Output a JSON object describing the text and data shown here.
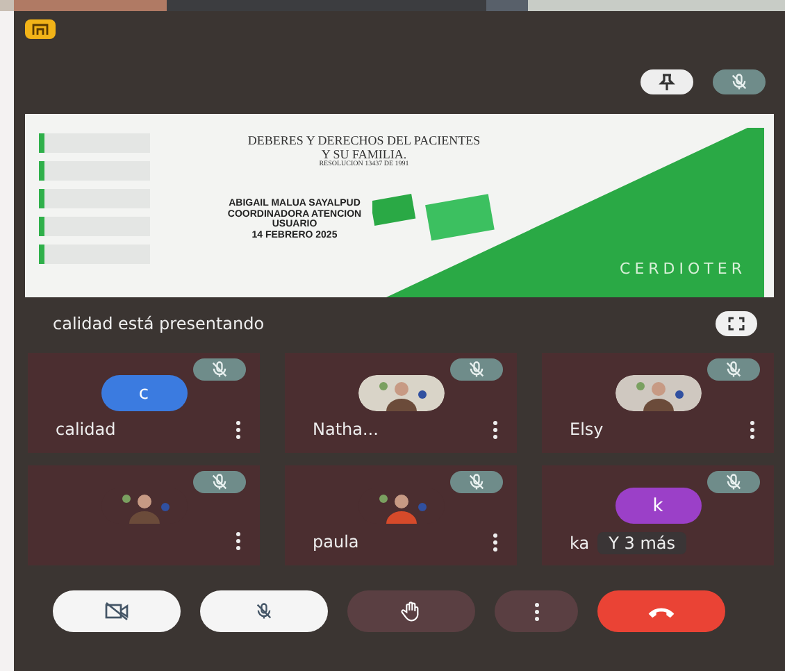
{
  "slide": {
    "title_lines": [
      "DEBERES Y DERECHOS DEL PACIENTES",
      "Y SU FAMILIA."
    ],
    "subtitle": "RESOLUCION 13437 DE 1991",
    "presenter_lines": [
      "ABIGAIL MALUA SAYALPUD",
      "COORDINADORA ATENCION",
      "USUARIO",
      "14 FEBRERO  2025"
    ],
    "brand": "CERDIOTER"
  },
  "presenting": "calidad está presentando",
  "participants": [
    {
      "name": "calidad",
      "kind": "letter",
      "letter": "c",
      "color": "#3b7be0",
      "muted": true
    },
    {
      "name": "Natha...",
      "kind": "picture",
      "muted": true
    },
    {
      "name": "Elsy",
      "kind": "picture",
      "muted": true
    },
    {
      "kind": "picture",
      "muted": true
    },
    {
      "name": "paula",
      "kind": "picture",
      "muted": true
    },
    {
      "name": "ka",
      "kind": "letter",
      "letter": "k",
      "color": "#9b40c8",
      "muted": true,
      "overflow": "Y 3 más"
    }
  ],
  "controls": [
    {
      "kind": "camera"
    },
    {
      "kind": "mic"
    },
    {
      "kind": "hand"
    },
    {
      "kind": "more"
    },
    {
      "kind": "hangup"
    }
  ]
}
